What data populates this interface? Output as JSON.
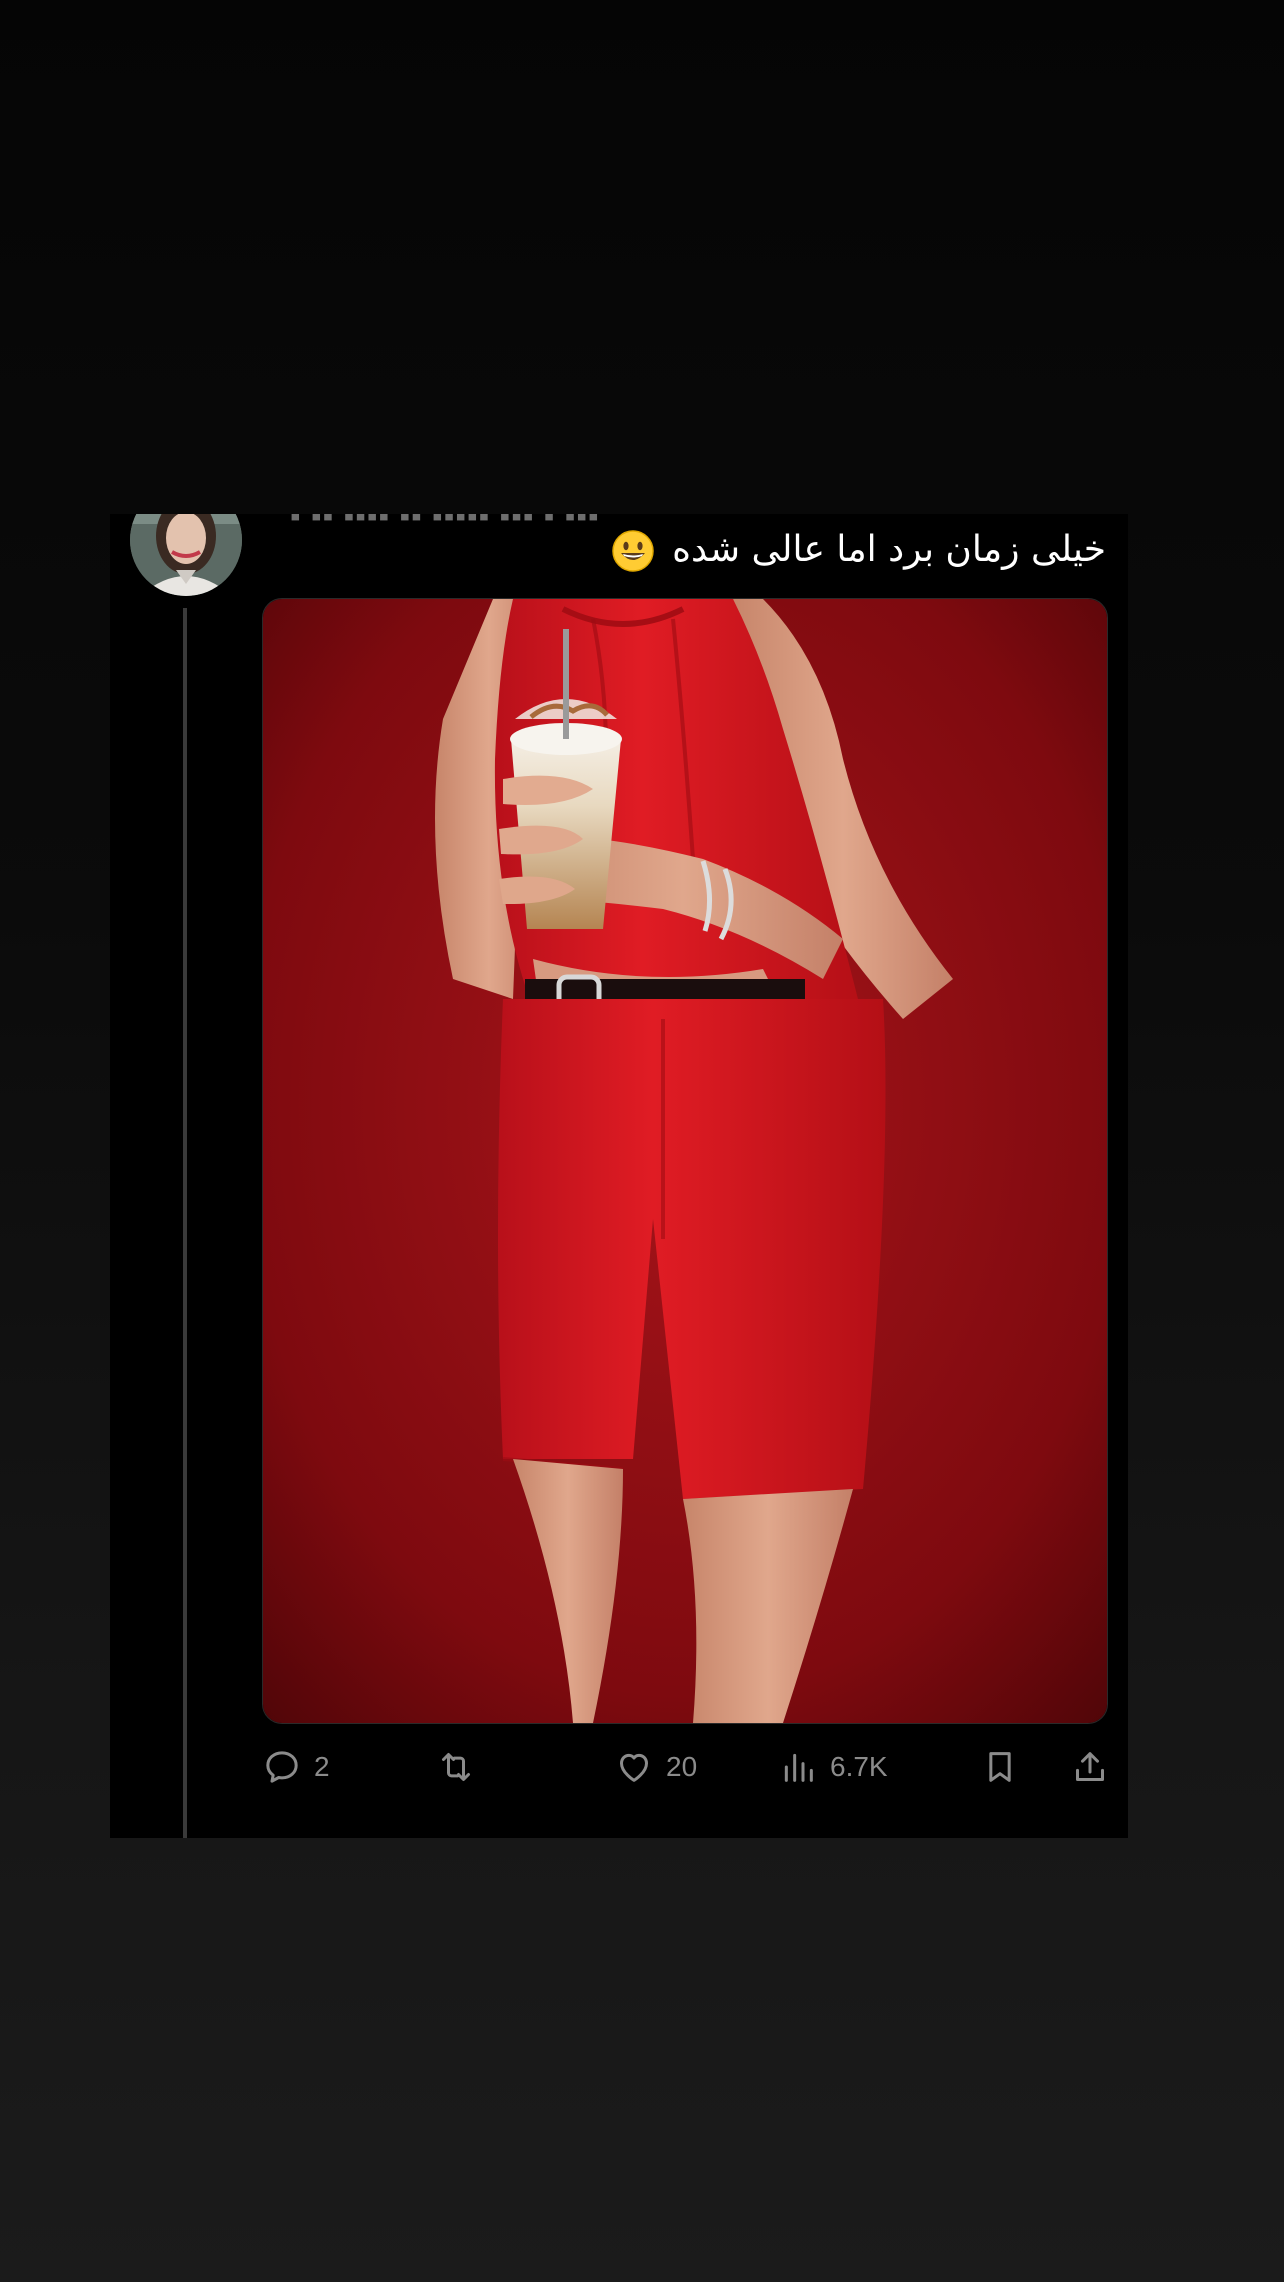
{
  "post": {
    "text": "خیلی زمان برد اما عالی شده",
    "emoji": "grinning-face-emoji",
    "media_alt": "Photo of a person in a red halter top and red shorts holding an iced coffee drink"
  },
  "actions": {
    "reply_count": "2",
    "retweet_count": "",
    "like_count": "20",
    "views_count": "6.7K"
  },
  "icons": {
    "reply": "reply-icon",
    "retweet": "retweet-icon",
    "like": "heart-icon",
    "views": "views-icon",
    "bookmark": "bookmark-icon",
    "share": "share-icon"
  },
  "colors": {
    "background": "#000000",
    "text": "#ffffff",
    "muted": "#8b8b8b",
    "photo_background": "#8e0a0e",
    "garment_red": "#d81b20"
  }
}
